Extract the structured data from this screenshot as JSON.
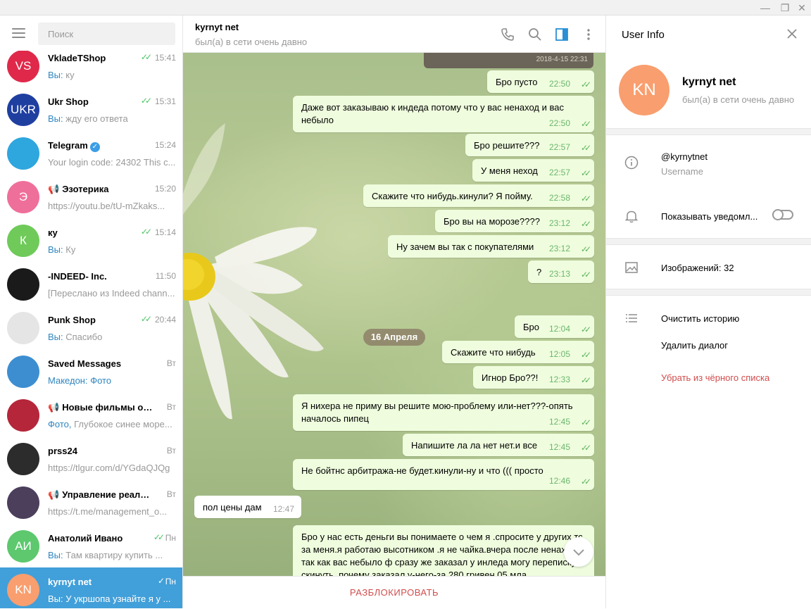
{
  "window": {
    "minimize": "—",
    "restore": "❐",
    "close": "✕"
  },
  "search": {
    "placeholder": "Поиск"
  },
  "chats": [
    {
      "name": "VkladeTShop",
      "avatar_text": "VS",
      "avatar_color": "#e0294a",
      "preview_prefix": "Вы:",
      "preview": " ку",
      "time": "15:41",
      "checked": true
    },
    {
      "name": "Ukr Shop",
      "avatar_text": "UKR",
      "avatar_color": "#1f3fa0",
      "preview_prefix": "Вы:",
      "preview": " жду его ответа",
      "time": "15:31",
      "checked": true
    },
    {
      "name": "Telegram",
      "avatar_text": "",
      "avatar_color": "#2ea6de",
      "preview_prefix": "",
      "preview": "Your login code: 24302  This c...",
      "time": "15:24",
      "checked": false,
      "verified": true
    },
    {
      "name": "Эзотерика",
      "avatar_text": "Э",
      "avatar_color": "#ef6f9b",
      "preview_prefix": "",
      "preview": "https://youtu.be/tU-mZkaks...",
      "time": "15:20",
      "checked": false,
      "channel": true
    },
    {
      "name": "ку",
      "avatar_text": "К",
      "avatar_color": "#6fca5a",
      "preview_prefix": "Вы:",
      "preview": " Ку",
      "time": "15:14",
      "checked": true
    },
    {
      "name": "-INDEED- Inc.",
      "avatar_text": "",
      "avatar_color": "#1a1a1a",
      "preview_prefix": "",
      "preview": "[Переслано из Indeed chann...",
      "time": "11:50",
      "checked": false
    },
    {
      "name": "Punk Shop",
      "avatar_text": "",
      "avatar_color": "#e5e5e5",
      "preview_prefix": "Вы:",
      "preview": " Спасибо",
      "time": "20:44",
      "checked": true
    },
    {
      "name": "Saved Messages",
      "avatar_text": "",
      "avatar_color": "#3d8ed1",
      "preview_prefix": "Македон: Фото",
      "preview": "",
      "time": "Вт",
      "checked": false
    },
    {
      "name": "Новые фильмы он...",
      "avatar_text": "",
      "avatar_color": "#b5263a",
      "preview_prefix": "Фото,",
      "preview": " Глубокое синее море...",
      "time": "Вт",
      "checked": false,
      "channel": true
    },
    {
      "name": "prss24",
      "avatar_text": "",
      "avatar_color": "#2c2c2c",
      "preview_prefix": "",
      "preview": "https://tlgur.com/d/YGdaQJQg",
      "time": "Вт",
      "checked": false
    },
    {
      "name": "Управление реальн...",
      "avatar_text": "",
      "avatar_color": "#4b3f5c",
      "preview_prefix": "",
      "preview": "https://t.me/management_o...",
      "time": "Вт",
      "checked": false,
      "channel": true
    },
    {
      "name": "Анатолий Ивано",
      "avatar_text": "АИ",
      "avatar_color": "#5dc86e",
      "preview_prefix": "Вы:",
      "preview": " Там квартиру купить ...",
      "time": "Пн",
      "checked": true
    },
    {
      "name": "kyrnyt net",
      "avatar_text": "KN",
      "avatar_color": "#f99e6e",
      "preview_prefix": "Вы:",
      "preview": " У укршопа узнайте я у ...",
      "time": "Пн",
      "checked": true,
      "active": true
    }
  ],
  "header": {
    "name": "kyrnyt net",
    "status": "был(а) в сети очень давно"
  },
  "photo_date": "2018-4-15 22:31",
  "messages": [
    {
      "text": "Бро пусто",
      "time": "22:50",
      "out": true
    },
    {
      "text": "Даже вот заказываю к индеда потому что у вас ненаход и вас небыло",
      "time": "22:50",
      "out": true
    },
    {
      "text": "Бро решите???",
      "time": "22:57",
      "out": true
    },
    {
      "text": "У меня неход",
      "time": "22:57",
      "out": true
    },
    {
      "text": "Скажите что нибудь.кинули? Я пойму.",
      "time": "22:58",
      "out": true
    },
    {
      "text": "Бро вы на морозе????",
      "time": "23:12",
      "out": true
    },
    {
      "text": "Ну зачем вы так с покупателями",
      "time": "23:12",
      "out": true
    },
    {
      "text": "?",
      "time": "23:13",
      "out": true
    },
    {
      "text": "Бро",
      "time": "12:04",
      "out": true
    },
    {
      "text": "Скажите что нибудь",
      "time": "12:05",
      "out": true
    },
    {
      "text": "Игнор Бро??!",
      "time": "12:33",
      "out": true
    },
    {
      "text": "Я нихера не приму вы решите мою-проблему или-нет???-опять началось пипец",
      "time": "12:45",
      "out": true
    },
    {
      "text": "Напишите ла ла нет нет.и все",
      "time": "12:45",
      "out": true
    },
    {
      "text": "Не бойтнс арбитража-не будет.кинули-ну и что ((( просто",
      "time": "12:46",
      "out": true
    },
    {
      "text": "пол цены дам",
      "time": "12:47",
      "out": false
    },
    {
      "text": "Бро у нас есть деньги вы понимаете о чем я .спросите у других тс за меня.я работаю высотником .я не чайка.вчера после ненахода так как вас небыло ф сразу же заказал у инледа могу переписку скинуть, почему заказал у-него-за 280 гривен 05 мла",
      "time": "",
      "out": true
    }
  ],
  "date_divider": "16 Апреля",
  "unblock_label": "РАЗБЛОКИРОВАТЬ",
  "user_info": {
    "title": "User Info",
    "avatar_text": "KN",
    "name": "kyrnyt net",
    "status": "был(а) в сети очень давно",
    "username": "@kyrnytnet",
    "username_label": "Username",
    "notifications_label": "Показывать уведомл...",
    "notifications_on": false,
    "images_label": "Изображений: 32",
    "clear_history": "Очистить историю",
    "delete_dialog": "Удалить диалог",
    "unblacklist": "Убрать из чёрного списка"
  }
}
